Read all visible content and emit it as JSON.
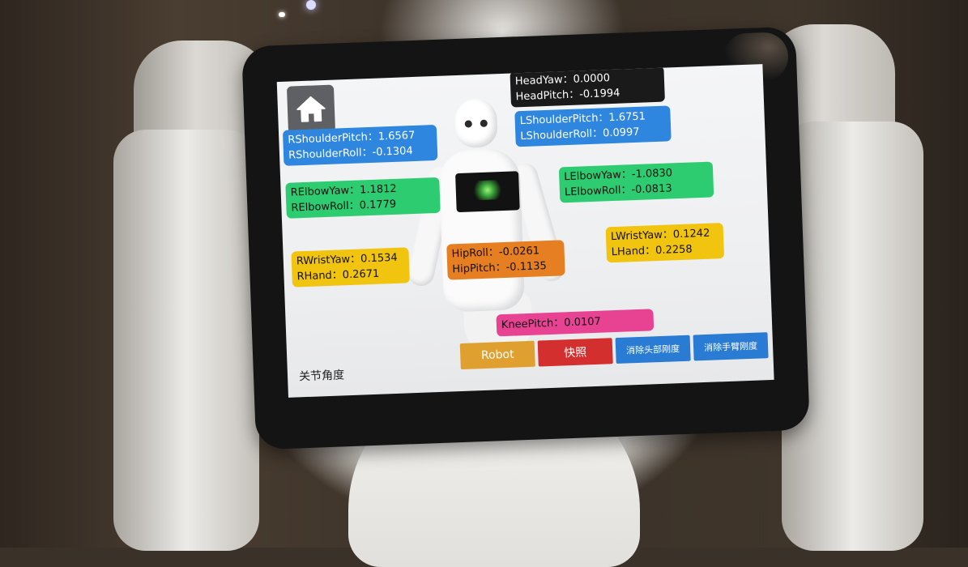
{
  "tablet": {
    "screen_title": "关节角度",
    "joints": {
      "head": {
        "yaw_label": "HeadYaw：",
        "yaw": "0.0000",
        "pitch_label": "HeadPitch：",
        "pitch": "-0.1994"
      },
      "left_shoulder": {
        "pitch_label": "LShoulderPitch：",
        "pitch": "1.6751",
        "roll_label": "LShoulderRoll：",
        "roll": "0.0997"
      },
      "right_shoulder": {
        "pitch_label": "RShoulderPitch：",
        "pitch": "1.6567",
        "roll_label": "RShoulderRoll：",
        "roll": "-0.1304"
      },
      "left_elbow": {
        "yaw_label": "LElbowYaw：",
        "yaw": "-1.0830",
        "roll_label": "LElbowRoll：",
        "roll": "-0.0813"
      },
      "right_elbow": {
        "yaw_label": "RElbowYaw：",
        "yaw": "1.1812",
        "roll_label": "RElbowRoll：",
        "roll": "0.1779"
      },
      "left_wrist": {
        "yaw_label": "LWristYaw：",
        "yaw": "0.1242",
        "hand_label": "LHand：",
        "hand": "0.2258"
      },
      "right_wrist": {
        "yaw_label": "RWristYaw：",
        "yaw": "0.1534",
        "hand_label": "RHand：",
        "hand": "0.2671"
      },
      "hip": {
        "roll_label": "HipRoll：",
        "roll": "-0.0261",
        "pitch_label": "HipPitch：",
        "pitch": "-0.1135"
      },
      "knee": {
        "pitch_label": "KneePitch：",
        "pitch": "0.0107"
      }
    },
    "buttons": {
      "robot": "Robot",
      "snapshot": "快照",
      "clear_head_stiffness": "消除头部刚度",
      "clear_arm_stiffness": "消除手臂刚度"
    },
    "colors": {
      "head_label": "#1a1a1a",
      "shoulder_label": "#2e86de",
      "elbow_label": "#2ecc71",
      "wrist_label": "#f1c40f",
      "hip_label": "#e67e22",
      "knee_label": "#e84393",
      "robot_button": "#e0a030",
      "snapshot_button": "#d32f2f",
      "clear_button": "#2a7bd4",
      "home_button": "#5f6064"
    },
    "icons": {
      "home": "home-icon"
    }
  }
}
